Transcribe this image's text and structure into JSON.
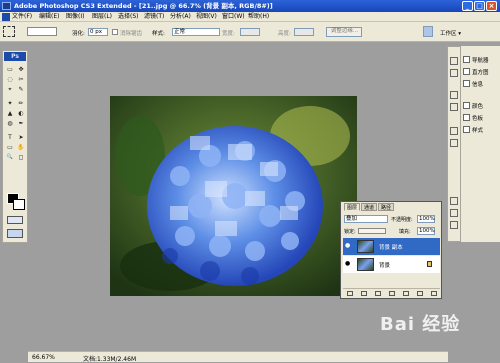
{
  "window": {
    "title": "Adobe Photoshop CS3 Extended - [21..jpg @ 66.7% (背景 副本, RGB/8#)]",
    "min": "_",
    "max": "□",
    "close": "×"
  },
  "menu": [
    "文件(F)",
    "编辑(E)",
    "图像(I)",
    "图层(L)",
    "选择(S)",
    "滤镜(T)",
    "分析(A)",
    "视图(V)",
    "窗口(W)",
    "帮助(H)"
  ],
  "options": {
    "feather_label": "羽化:",
    "feather_value": "0 px",
    "antialias_label": "消除锯齿",
    "style_label": "样式:",
    "style_value": "正常",
    "width_label": "宽度:",
    "height_label": "高度:",
    "refine_label": "调整边缘...",
    "workspace_label": "工作区 ▾"
  },
  "toolbox": {
    "header": "Ps",
    "tools": [
      "▭",
      "✥",
      "◌",
      "✂",
      "⌖",
      "✎",
      "✦",
      "✏",
      "▲",
      "◐",
      "◍",
      "✒",
      "T",
      "➤",
      "▭",
      "✋",
      "🔍",
      "◻"
    ]
  },
  "panels": {
    "items": [
      "导航器",
      "直方图",
      "信息",
      "颜色",
      "色板",
      "样式"
    ]
  },
  "layers": {
    "tabs": [
      "图层",
      "通道",
      "路径"
    ],
    "blend": "叠加",
    "opacity_label": "不透明度:",
    "opacity_value": "100%",
    "lock_label": "锁定:",
    "fill_label": "填充:",
    "fill_value": "100%",
    "rows": [
      {
        "name": "背景 副本",
        "selected": true
      },
      {
        "name": "背景",
        "locked": true
      }
    ]
  },
  "status": {
    "zoom": "66.67%",
    "doc": "文档:1.33M/2.46M"
  },
  "watermark": "Bai 经验",
  "colors": {
    "accent": "#316ac5",
    "title_blue": "#1746b8"
  }
}
